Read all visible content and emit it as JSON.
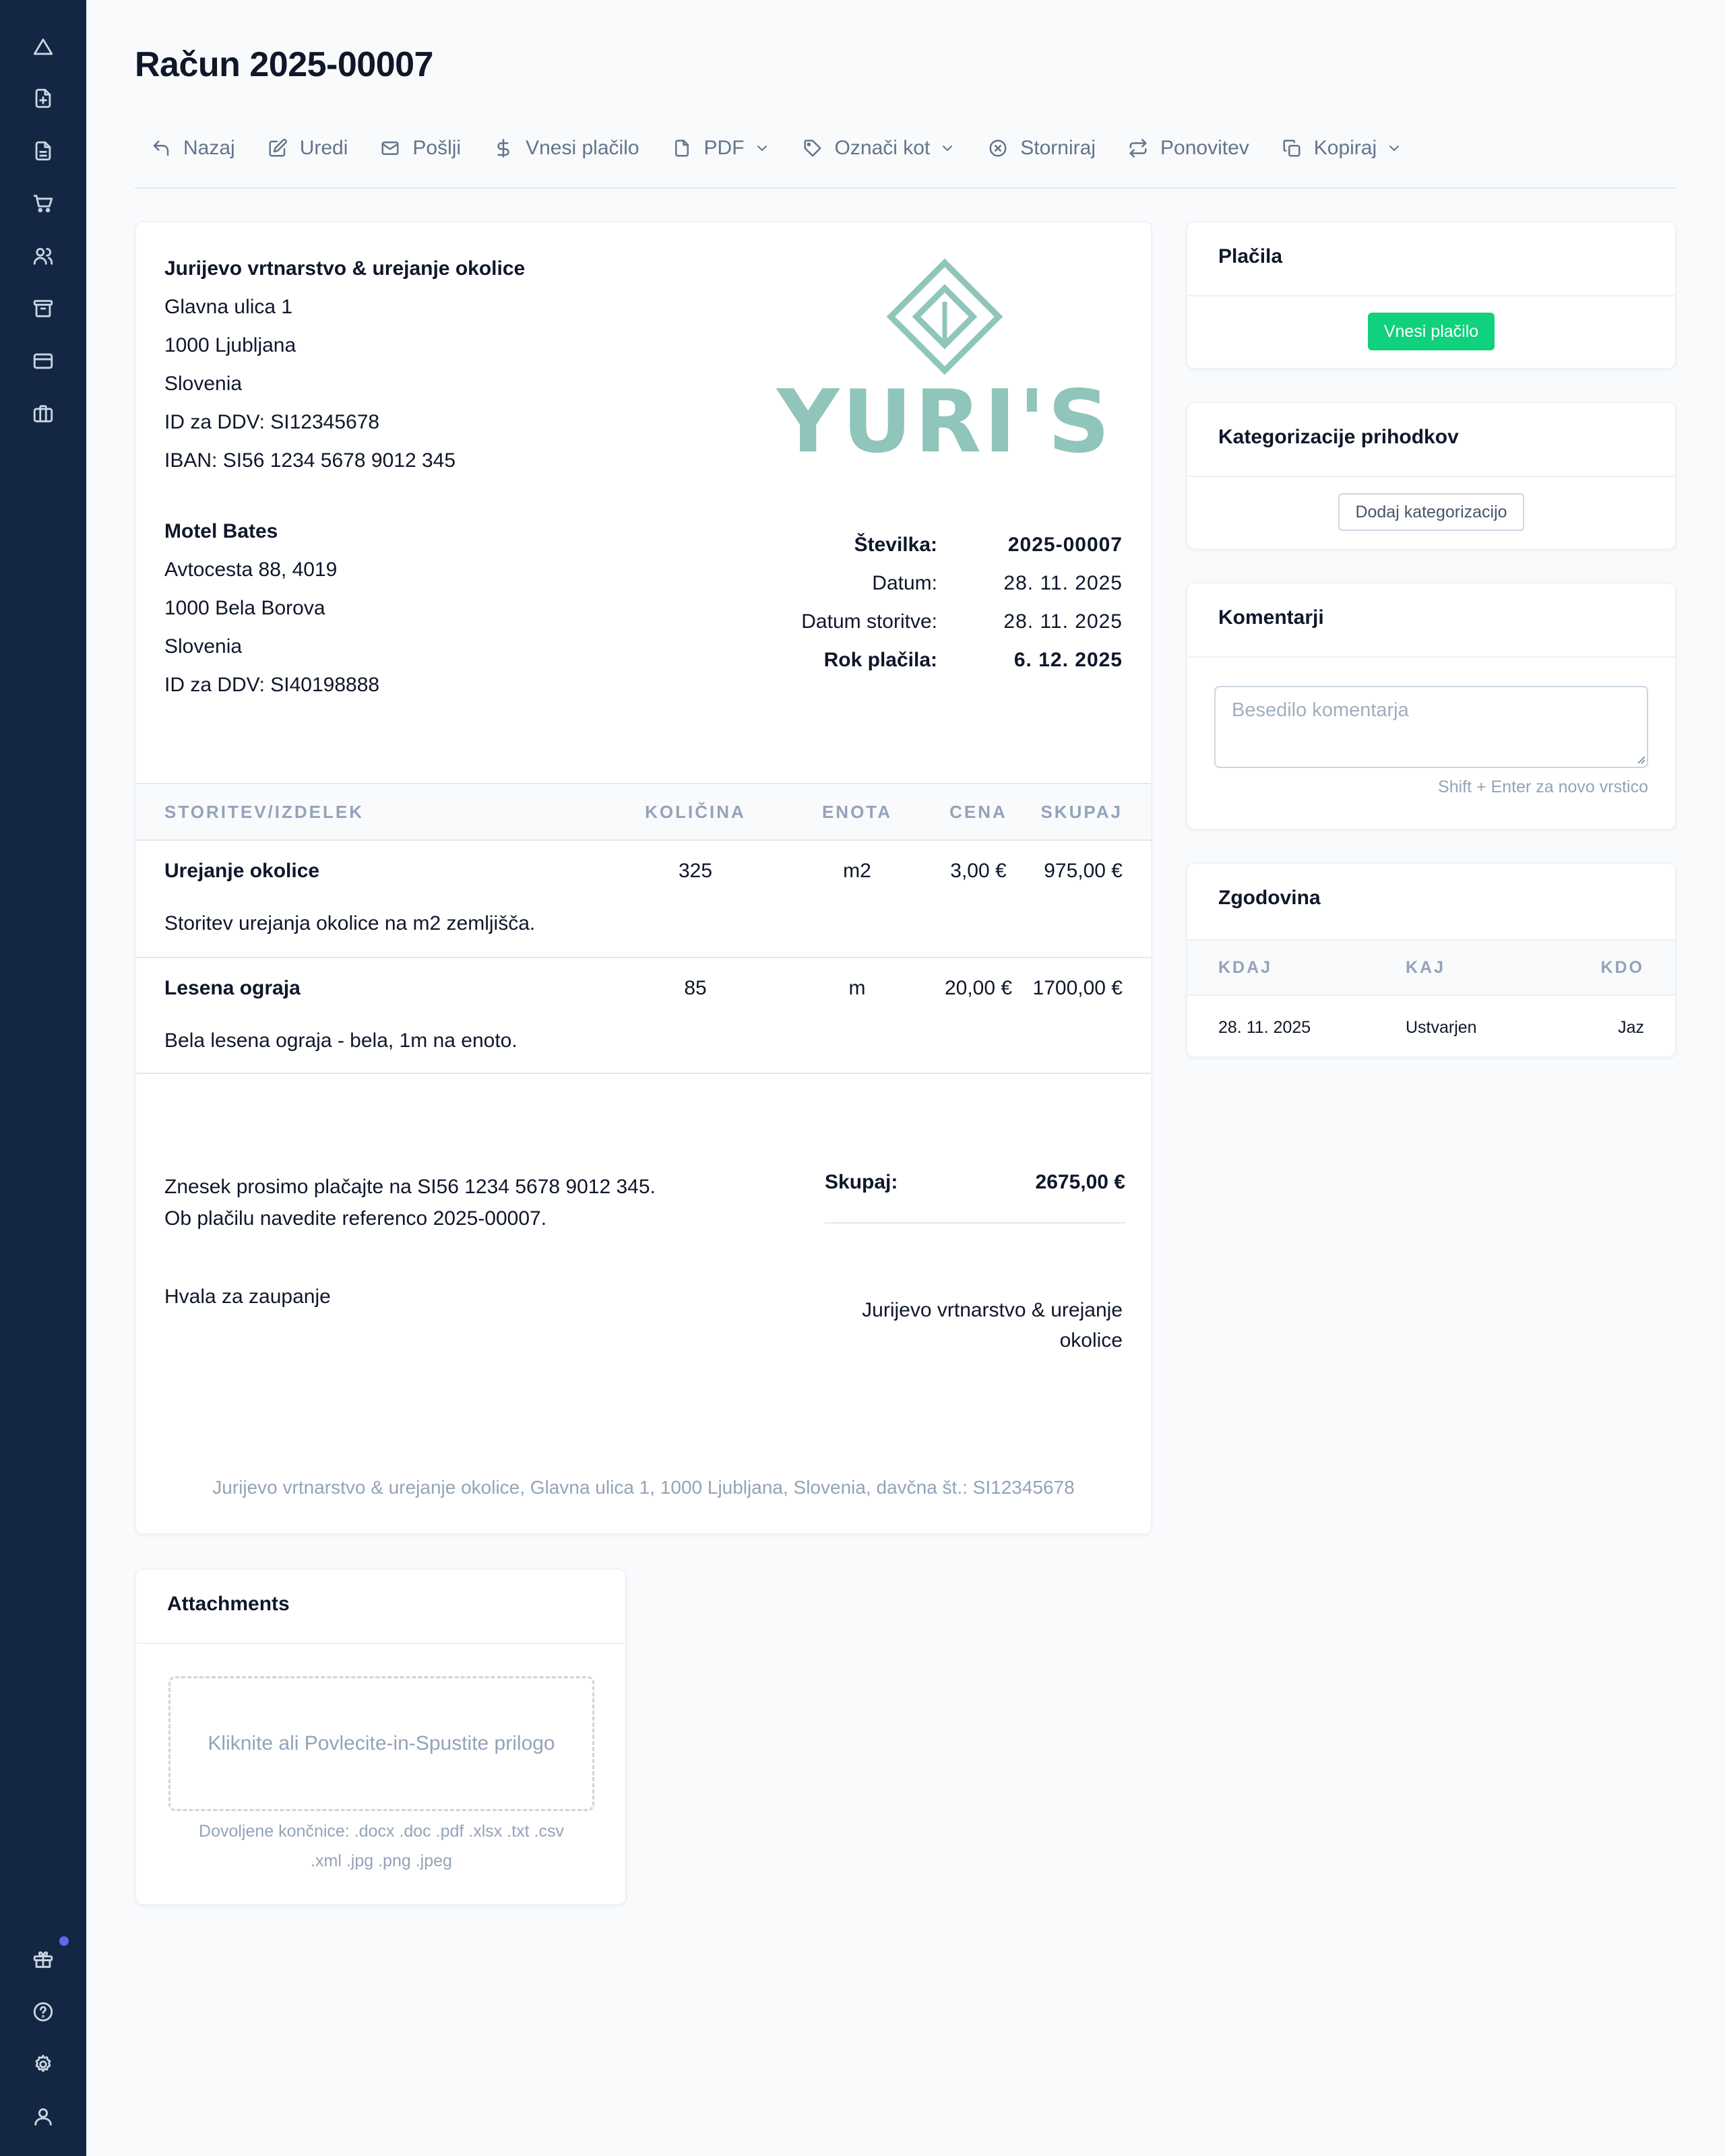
{
  "sidebar": {
    "icons": [
      "triangle-icon",
      "document-plus-icon",
      "document-icon",
      "cart-icon",
      "users-icon",
      "archive-icon",
      "credit-card-icon",
      "briefcase-icon",
      "gift-icon",
      "help-icon",
      "settings-icon",
      "user-icon"
    ]
  },
  "page": {
    "title": "Račun 2025-00007"
  },
  "toolbar": {
    "back": "Nazaj",
    "edit": "Uredi",
    "send": "Pošlji",
    "payment": "Vnesi plačilo",
    "pdf": "PDF",
    "mark_as": "Označi kot",
    "cancel": "Storniraj",
    "repeat": "Ponovitev",
    "copy": "Kopiraj"
  },
  "invoice": {
    "seller": {
      "name": "Jurijevo vrtnarstvo & urejanje okolice",
      "address": "Glavna ulica 1",
      "city": "1000 Ljubljana",
      "country": "Slovenia",
      "vat": "ID za DDV: SI12345678",
      "iban": "IBAN: SI56 1234 5678 9012 345"
    },
    "logo_text": "YURI'S",
    "buyer": {
      "name": "Motel Bates",
      "address": "Avtocesta 88, 4019",
      "city": "1000 Bela Borova",
      "country": "Slovenia",
      "vat": "ID za DDV: SI40198888"
    },
    "meta": [
      {
        "label": "Številka:",
        "value": "2025-00007",
        "bold": true
      },
      {
        "label": "Datum:",
        "value": "28. 11. 2025",
        "bold": false
      },
      {
        "label": "Datum storitve:",
        "value": "28. 11. 2025",
        "bold": false
      },
      {
        "label": "Rok plačila:",
        "value": "6. 12. 2025",
        "bold": true
      }
    ],
    "columns": {
      "name": "STORITEV/IZDELEK",
      "qty": "KOLIČINA",
      "unit": "ENOTA",
      "price": "CENA",
      "total": "SKUPAJ"
    },
    "items": [
      {
        "name": "Urejanje okolice",
        "qty": "325",
        "unit": "m2",
        "price": "3,00 €",
        "total": "975,00 €",
        "description": "Storitev urejanja okolice na m2 zemljišča."
      },
      {
        "name": "Lesena ograja",
        "qty": "85",
        "unit": "m",
        "price": "20,00 €",
        "total": "1700,00 €",
        "description": "Bela lesena ograja - bela, 1m na enoto."
      }
    ],
    "payment_note_1": "Znesek prosimo plačajte na SI56 1234 5678 9012 345.",
    "payment_note_2": "Ob plačilu navedite referenco 2025-00007.",
    "total_label": "Skupaj:",
    "total_value": "2675,00 €",
    "thanks": "Hvala za zaupanje",
    "signature": "Jurijevo vrtnarstvo & urejanje okolice",
    "footer": "Jurijevo vrtnarstvo & urejanje okolice, Glavna ulica 1, 1000 Ljubljana, Slovenia, davčna št.: SI12345678"
  },
  "payments": {
    "title": "Plačila",
    "button": "Vnesi plačilo",
    "button_color": "#10d17c"
  },
  "categorizations": {
    "title": "Kategorizacije prihodkov",
    "button": "Dodaj kategorizacijo"
  },
  "comments": {
    "title": "Komentarji",
    "placeholder": "Besedilo komentarja",
    "hint": "Shift + Enter za novo vrstico"
  },
  "history": {
    "title": "Zgodovina",
    "columns": {
      "when": "KDAJ",
      "what": "KAJ",
      "who": "KDO"
    },
    "rows": [
      {
        "when": "28. 11. 2025",
        "what": "Ustvarjen",
        "who": "Jaz"
      }
    ]
  },
  "attachments": {
    "title": "Attachments",
    "dropzone": "Kliknite ali Povlecite-in-Spustite prilogo",
    "allowed_1": "Dovoljene končnice: .docx .doc .pdf .xlsx .txt .csv",
    "allowed_2": ".xml .jpg .png .jpeg"
  },
  "colors": {
    "sidebar": "#132744",
    "logo": "#8fc5bb",
    "accent_green": "#10d17c",
    "notification_dot": "#6366f1"
  }
}
